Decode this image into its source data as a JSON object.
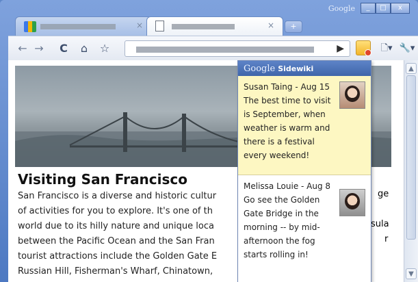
{
  "window": {
    "brand": "Google",
    "buttons": {
      "minimize": "_",
      "maximize": "□",
      "close": "x"
    }
  },
  "tabs": [
    {
      "close": "×"
    },
    {
      "close": "×"
    }
  ],
  "toolbar": {
    "back": "←",
    "forward": "→",
    "reload": "C",
    "home": "⌂",
    "bookmark": "☆",
    "go": "▶",
    "page_menu": "🗋▾",
    "wrench_menu": "🔧▾"
  },
  "page": {
    "heading": "Visiting San Francisco",
    "lines": [
      "San Francisco is a diverse and historic cultur",
      "of activities for you to explore. It's one of th",
      "world due to its hilly nature and unique loca",
      "between the Pacific Ocean and the San Fran",
      "tourist attractions include the Golden Gate E",
      "Russian Hill, Fisherman's Wharf, Chinatown,"
    ],
    "right_fragments": [
      "ge",
      "sula",
      "r"
    ]
  },
  "sidewiki": {
    "brand": "Google",
    "title": "Sidewiki",
    "entries": [
      {
        "author": "Susan Taing - Aug 15",
        "comment": "The best time to visit is September, when weather is warm and there is a festival every weekend!"
      },
      {
        "author": "Melissa Louie - Aug 8",
        "comment": "Go see the Golden Gate Bridge in the morning -- by mid-afternoon the fog starts rolling in!"
      }
    ]
  }
}
